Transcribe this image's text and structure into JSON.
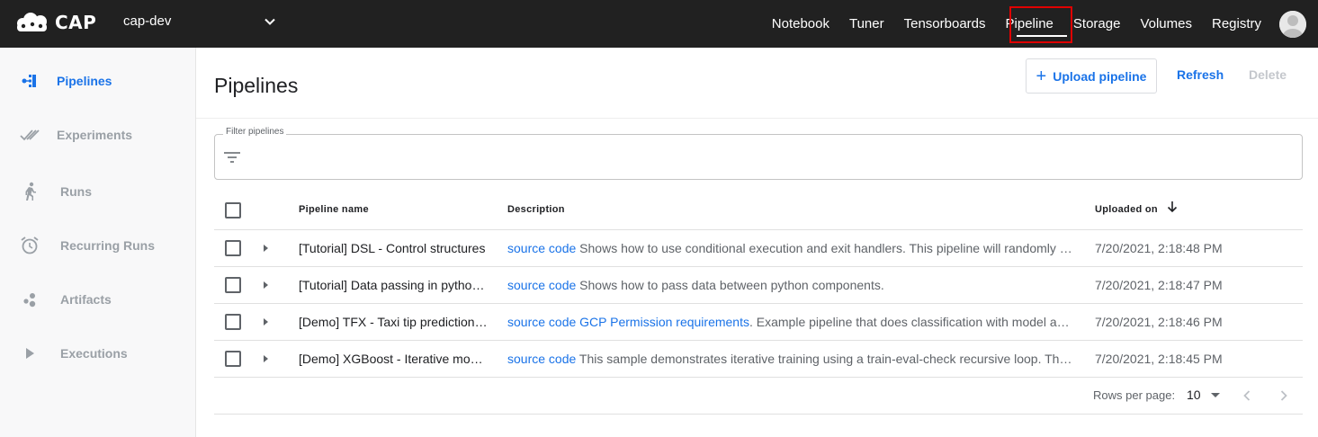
{
  "topbar": {
    "logo_text": "CAP",
    "namespace": "cap-dev",
    "nav": [
      "Notebook",
      "Tuner",
      "Tensorboards",
      "Pipeline",
      "Storage",
      "Volumes",
      "Registry"
    ],
    "active_nav": "Pipeline"
  },
  "sidebar": {
    "items": [
      {
        "label": "Pipelines",
        "icon": "pipelines-icon",
        "active": true
      },
      {
        "label": "Experiments",
        "icon": "experiments-icon",
        "active": false
      },
      {
        "label": "Runs",
        "icon": "runs-icon",
        "active": false
      },
      {
        "label": "Recurring Runs",
        "icon": "alarm-clock-icon",
        "active": false
      },
      {
        "label": "Artifacts",
        "icon": "artifacts-icon",
        "active": false
      },
      {
        "label": "Executions",
        "icon": "play-icon",
        "active": false
      }
    ]
  },
  "main": {
    "title": "Pipelines",
    "upload_label": "Upload pipeline",
    "refresh_label": "Refresh",
    "delete_label": "Delete",
    "filter_label": "Filter pipelines",
    "filter_value": "",
    "columns": {
      "name": "Pipeline name",
      "description": "Description",
      "uploaded": "Uploaded on"
    },
    "rows": [
      {
        "name": "[Tutorial] DSL - Control structures",
        "link": "source code",
        "link2": "",
        "description": " Shows how to use conditional execution and exit handlers. This pipeline will randomly fail to demonstrate that the exit handler gets executed even in case of failure.",
        "uploaded": "7/20/2021, 2:18:48 PM"
      },
      {
        "name": "[Tutorial] Data passing in python components",
        "link": "source code",
        "link2": "",
        "description": " Shows how to pass data between python components.",
        "uploaded": "7/20/2021, 2:18:47 PM"
      },
      {
        "name": "[Demo] TFX - Taxi tip prediction model trainer",
        "link": "source code",
        "link2": " GCP Permission requirements",
        "description": ". Example pipeline that does classification with model analysis based on a public BigQuery dataset.",
        "uploaded": "7/20/2021, 2:18:46 PM"
      },
      {
        "name": "[Demo] XGBoost - Iterative model training",
        "link": "source code",
        "link2": "",
        "description": " This sample demonstrates iterative training using a train-eval-check recursive loop. The main pipeline trains the initial model and then gradually trains the model some more until the model evaluation metrics are good enough.",
        "uploaded": "7/20/2021, 2:18:45 PM"
      }
    ],
    "pager": {
      "rows_label": "Rows per page:",
      "rows_value": "10"
    }
  },
  "colors": {
    "accent": "#1a73e8",
    "topbar": "#212121",
    "highlight": "#e00000"
  }
}
